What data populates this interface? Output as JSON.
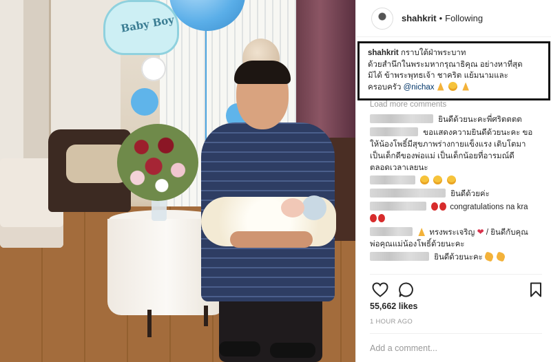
{
  "post": {
    "username": "shahkrit",
    "separator": "•",
    "follow_status": "Following",
    "caption": {
      "user": "shahkrit",
      "line1": "กราบใต้ฝ่าพระบาท",
      "line2": "ด้วยสำนึกในพระมหากรุณาธิคุณ อย่างหาที่สุด",
      "line3": "มิได้ ข้าพระพุทธเจ้า ชาคริต แย้มนามและ",
      "line4_text": "ครอบครัว",
      "mention": "@nichax"
    },
    "load_more": "Load more comments",
    "comments": [
      {
        "line1": "ยินดีด้วยนะคะพี่ศริตตตต"
      },
      {
        "line1": "ขอแสดงความยินดีด้วยนะคะ ขอ",
        "line2": "ให้น้องโพธิ์มีสุขภาพร่างกายแข็งแรง เติบโตมา",
        "line3": "เป็นเด็กดีของพ่อแม่ เป็นเด็กน้อยที่อารมณ์ดี",
        "line4": "ตลอดเวลาเลยนะ"
      },
      {
        "line1": ""
      },
      {
        "line1": "ยินดีด้วยค่ะ"
      },
      {
        "line1": "congratulations na kra"
      },
      {
        "line1": "ทรงพระเจริญ",
        "line1b": "/ ยินดีกับคุณ",
        "line2": "พ่อคุณแม่น้องโพธิ์ด้วยนะคะ"
      },
      {
        "line1": "ยินดีด้วยนะคะ"
      }
    ],
    "likes": "55,662 likes",
    "time": "1 HOUR AGO",
    "add_comment_placeholder": "Add a comment..."
  },
  "photo": {
    "balloon_text": "Baby Boy"
  },
  "icons": {
    "like": "heart-outline-icon",
    "comment": "comment-bubble-icon",
    "save": "bookmark-icon"
  },
  "colors": {
    "text": "#262626",
    "muted": "#999999",
    "link": "#003569",
    "caption_border": "#111111"
  }
}
